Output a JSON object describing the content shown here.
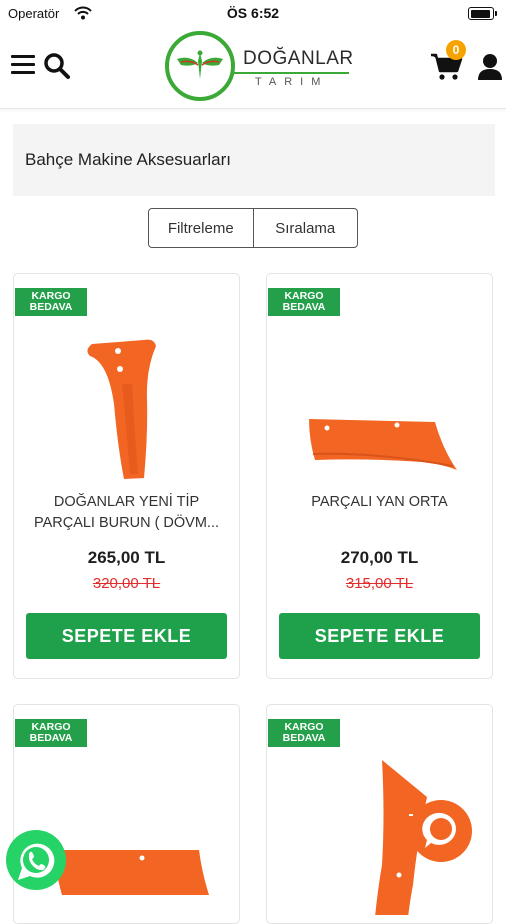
{
  "status_bar": {
    "carrier": "Operatör",
    "time": "ÖS 6:52"
  },
  "header": {
    "logo_brand": "DOĞANLAR",
    "logo_sub": "TARIM",
    "cart_count": "0",
    "icons": [
      "menu-icon",
      "search-icon",
      "cart-icon",
      "user-icon"
    ]
  },
  "category": {
    "title": "Bahçe Makine Aksesuarları"
  },
  "sort_bar": {
    "filter_label": "Filtreleme",
    "sort_label": "Sıralama"
  },
  "products": [
    {
      "badge_line1": "KARGO",
      "badge_line2": "BEDAVA",
      "name": "DOĞANLAR YENİ TİP PARÇALI BURUN ( DÖVM...",
      "price": "265,00 TL",
      "old_price": "320,00 TL",
      "button": "SEPETE EKLE"
    },
    {
      "badge_line1": "KARGO",
      "badge_line2": "BEDAVA",
      "name": "PARÇALI YAN ORTA",
      "price": "270,00 TL",
      "old_price": "315,00 TL",
      "button": "SEPETE EKLE"
    },
    {
      "badge_line1": "KARGO",
      "badge_line2": "BEDAVA"
    },
    {
      "badge_line1": "KARGO",
      "badge_line2": "BEDAVA"
    }
  ],
  "colors": {
    "brand_green": "#1ea14a",
    "badge_green": "#24a04a",
    "old_price_red": "#e32d2d",
    "cart_badge": "#f6a300",
    "product_orange": "#f26522",
    "chat_orange": "#f26522",
    "whatsapp_green": "#25d366"
  }
}
